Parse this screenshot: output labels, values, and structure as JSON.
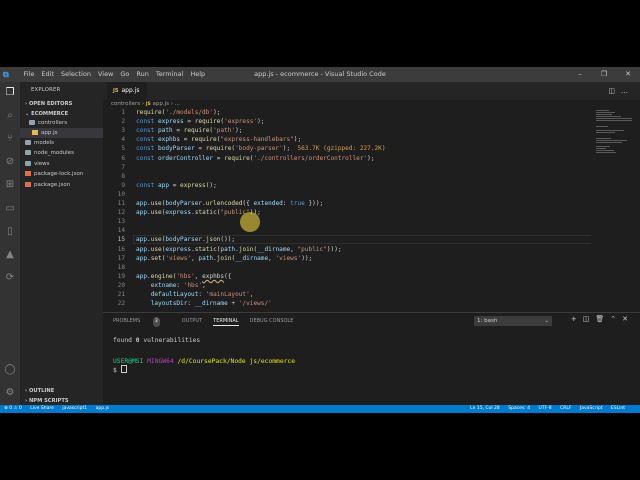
{
  "window": {
    "title": "app.js - ecommerce - Visual Studio Code",
    "menu": [
      "File",
      "Edit",
      "Selection",
      "View",
      "Go",
      "Run",
      "Terminal",
      "Help"
    ],
    "controls": [
      "–",
      "❐",
      "✕"
    ]
  },
  "sidebar": {
    "header": "EXPLORER",
    "open_editors": "OPEN EDITORS",
    "project": "ECOMMERCE",
    "items": [
      {
        "label": "controllers",
        "type": "folder"
      },
      {
        "label": "app.js",
        "type": "js"
      },
      {
        "label": "models",
        "type": "folder"
      },
      {
        "label": "node_modules",
        "type": "folder"
      },
      {
        "label": "views",
        "type": "folder"
      },
      {
        "label": "package-lock.json",
        "type": "json"
      },
      {
        "label": "package.json",
        "type": "json"
      }
    ],
    "outline": "OUTLINE",
    "npm_scripts": "NPM SCRIPTS"
  },
  "editor": {
    "tab": {
      "icon": "JS",
      "label": "app.js"
    },
    "breadcrumb": [
      "controllers",
      "JS",
      "app.js",
      "..."
    ],
    "line_numbers": [
      "1",
      "2",
      "3",
      "4",
      "5",
      "6",
      "7",
      "8",
      "9",
      "10",
      "11",
      "12",
      "13",
      "14",
      "15",
      "16",
      "17",
      "18",
      "19",
      "20",
      "21",
      "22"
    ],
    "lines": [
      [
        [
          "fn",
          "require"
        ],
        [
          "plain",
          "("
        ],
        [
          "str",
          "'./models/db'"
        ],
        [
          "plain",
          ");"
        ]
      ],
      [
        [
          "kw",
          "const "
        ],
        [
          "var",
          "express"
        ],
        [
          "plain",
          " = "
        ],
        [
          "fn",
          "require"
        ],
        [
          "plain",
          "("
        ],
        [
          "str",
          "'express'"
        ],
        [
          "plain",
          ");"
        ]
      ],
      [
        [
          "kw",
          "const "
        ],
        [
          "var",
          "path"
        ],
        [
          "plain",
          " = "
        ],
        [
          "fn",
          "require"
        ],
        [
          "plain",
          "("
        ],
        [
          "str",
          "'path'"
        ],
        [
          "plain",
          ");"
        ]
      ],
      [
        [
          "kw",
          "const "
        ],
        [
          "var",
          "exphbs"
        ],
        [
          "plain",
          " = "
        ],
        [
          "fn",
          "require"
        ],
        [
          "plain",
          "("
        ],
        [
          "str",
          "\"express-handlebars\""
        ],
        [
          "plain",
          ");"
        ]
      ],
      [
        [
          "kw",
          "const "
        ],
        [
          "var",
          "bodyParser"
        ],
        [
          "plain",
          " = "
        ],
        [
          "fn",
          "require"
        ],
        [
          "plain",
          "("
        ],
        [
          "str",
          "'body-parser'"
        ],
        [
          "plain",
          ");  "
        ],
        [
          "sz",
          "563.7K (gzipped: 227.2K)"
        ]
      ],
      [
        [
          "kw",
          "const "
        ],
        [
          "var",
          "orderController"
        ],
        [
          "plain",
          " = "
        ],
        [
          "fn",
          "require"
        ],
        [
          "plain",
          "("
        ],
        [
          "str",
          "'./controllers/orderController'"
        ],
        [
          "plain",
          ");"
        ]
      ],
      [],
      [],
      [
        [
          "kw",
          "const "
        ],
        [
          "var",
          "app"
        ],
        [
          "plain",
          " = "
        ],
        [
          "fn",
          "express"
        ],
        [
          "plain",
          "();"
        ]
      ],
      [],
      [
        [
          "var",
          "app"
        ],
        [
          "plain",
          "."
        ],
        [
          "fn",
          "use"
        ],
        [
          "plain",
          "("
        ],
        [
          "var",
          "bodyParser"
        ],
        [
          "plain",
          "."
        ],
        [
          "fn",
          "urlencoded"
        ],
        [
          "plain",
          "({ "
        ],
        [
          "var",
          "extended"
        ],
        [
          "plain",
          ": "
        ],
        [
          "kw",
          "true"
        ],
        [
          "plain",
          " }));"
        ]
      ],
      [
        [
          "var",
          "app"
        ],
        [
          "plain",
          "."
        ],
        [
          "fn",
          "use"
        ],
        [
          "plain",
          "("
        ],
        [
          "var",
          "express"
        ],
        [
          "plain",
          "."
        ],
        [
          "fn",
          "static"
        ],
        [
          "plain",
          "("
        ],
        [
          "str",
          "\"public\""
        ],
        [
          "plain",
          "));"
        ]
      ],
      [],
      [],
      [
        [
          "var",
          "app"
        ],
        [
          "plain",
          "."
        ],
        [
          "fn",
          "use"
        ],
        [
          "plain",
          "("
        ],
        [
          "var",
          "bodyParser"
        ],
        [
          "plain",
          "."
        ],
        [
          "fn",
          "json"
        ],
        [
          "plain",
          "());"
        ]
      ],
      [
        [
          "var",
          "app"
        ],
        [
          "plain",
          "."
        ],
        [
          "fn",
          "use"
        ],
        [
          "plain",
          "("
        ],
        [
          "var",
          "express"
        ],
        [
          "plain",
          "."
        ],
        [
          "fn",
          "static"
        ],
        [
          "plain",
          "("
        ],
        [
          "var",
          "path"
        ],
        [
          "plain",
          "."
        ],
        [
          "fn",
          "join"
        ],
        [
          "plain",
          "("
        ],
        [
          "var",
          "__dirname"
        ],
        [
          "plain",
          ", "
        ],
        [
          "str",
          "\"public\""
        ],
        [
          "plain",
          ")));"
        ]
      ],
      [
        [
          "var",
          "app"
        ],
        [
          "plain",
          "."
        ],
        [
          "fn",
          "set"
        ],
        [
          "plain",
          "("
        ],
        [
          "str",
          "'views'"
        ],
        [
          "plain",
          ", "
        ],
        [
          "var",
          "path"
        ],
        [
          "plain",
          "."
        ],
        [
          "fn",
          "join"
        ],
        [
          "plain",
          "("
        ],
        [
          "var",
          "__dirname"
        ],
        [
          "plain",
          ", "
        ],
        [
          "str",
          "'views'"
        ],
        [
          "plain",
          "));"
        ]
      ],
      [],
      [
        [
          "var",
          "app"
        ],
        [
          "plain",
          "."
        ],
        [
          "fn",
          "engine"
        ],
        [
          "plain",
          "("
        ],
        [
          "str",
          "'hbs'"
        ],
        [
          "plain",
          ", "
        ],
        [
          "squig",
          "exphbs"
        ],
        [
          "plain",
          "({"
        ]
      ],
      [
        [
          "plain",
          "    "
        ],
        [
          "var",
          "extname"
        ],
        [
          "plain",
          ": "
        ],
        [
          "str",
          "'hbs'"
        ],
        [
          "plain",
          ","
        ]
      ],
      [
        [
          "plain",
          "    "
        ],
        [
          "var",
          "defaultLayout"
        ],
        [
          "plain",
          ": "
        ],
        [
          "str",
          "'mainLayout'"
        ],
        [
          "plain",
          ","
        ]
      ],
      [
        [
          "plain",
          "    "
        ],
        [
          "var",
          "layoutsDir"
        ],
        [
          "plain",
          ": "
        ],
        [
          "var",
          "__dirname"
        ],
        [
          "plain",
          " + "
        ],
        [
          "str",
          "'/views/'"
        ]
      ]
    ],
    "current_line": 15
  },
  "panel": {
    "tabs": [
      "PROBLEMS",
      "OUTPUT",
      "TERMINAL",
      "DEBUG CONSOLE"
    ],
    "problems_count": "3",
    "active_tab": "TERMINAL",
    "terminal_select": "1: bash",
    "terminal": {
      "line1_pre": "found ",
      "line1_num": "0",
      "line1_post": " vulnerabilities",
      "user": "USER@MSI",
      "shell": "MINGW64",
      "path": "/d/CoursePack/Node js/ecommerce",
      "prompt": "$"
    }
  },
  "statusbar": {
    "left": [
      "⊗ 0 ⚠ 0",
      "Live Share",
      "javascript1",
      "app.js"
    ],
    "right": [
      "Ln 15, Col 28",
      "Spaces: 4",
      "UTF-8",
      "CRLF",
      "JavaScript",
      "ESLint"
    ]
  }
}
